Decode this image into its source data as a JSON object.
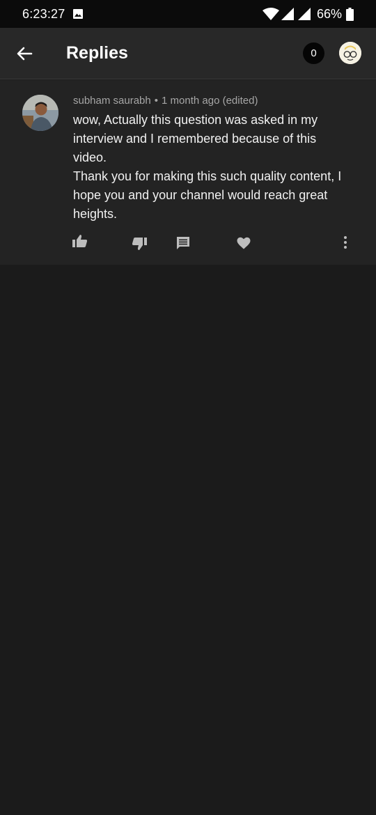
{
  "status_bar": {
    "time": "6:23:27",
    "battery_percent": "66%",
    "icons": [
      "image-notification-icon",
      "wifi-icon",
      "signal-icon",
      "signal-icon-2",
      "battery-icon"
    ]
  },
  "app_bar": {
    "back_icon": "arrow-left-icon",
    "title": "Replies",
    "notification_count": "0",
    "account_icon": "account-avatar"
  },
  "comment": {
    "author": "subham saurabh",
    "separator": "•",
    "time": "1 month ago (edited)",
    "lines": [
      "wow, Actually this question was asked in my interview and I remembered because of this video.",
      "Thank you for making this such quality content, I hope you and your channel would reach great heights."
    ],
    "actions": [
      "like-icon",
      "dislike-icon",
      "reply-icon",
      "heart-icon",
      "more-vert-icon"
    ]
  },
  "colors": {
    "background": "#1b1b1b",
    "app_bar": "#282828",
    "card": "#232323",
    "meta_text": "#a6a6a6",
    "icon": "#bdbdbd"
  }
}
